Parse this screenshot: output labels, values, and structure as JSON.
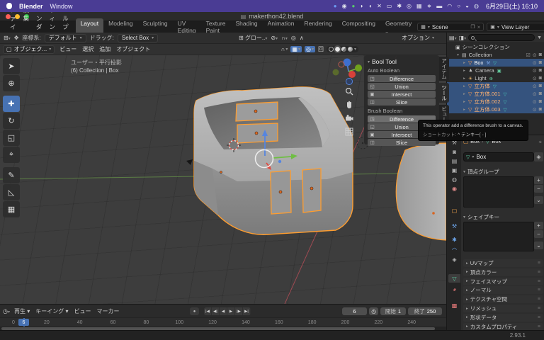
{
  "colors": {
    "accent_blue": "#4772b3",
    "selection_orange": "#ff9d2e",
    "menubar_purple": "#4a3c94",
    "axis_green": "#5c7e45",
    "axis_red": "#9e4a52"
  },
  "menubar": {
    "app_name": "Blender",
    "menus": [
      "Window"
    ],
    "clock": "6月29日(土) 16:10",
    "status_icons": [
      {
        "name": "app-icon-blue",
        "glyph": "●",
        "color": "#6b9bf2"
      },
      {
        "name": "app-icon-camera",
        "glyph": "◉",
        "color": "#dfe3ec"
      },
      {
        "name": "app-icon-green",
        "glyph": "●",
        "color": "#57c76d"
      },
      {
        "name": "speech-icon",
        "glyph": "◗",
        "color": "#e8e8f2"
      },
      {
        "name": "volume-icon",
        "glyph": "◖",
        "color": "#e8e8f2"
      },
      {
        "name": "cut-icon",
        "glyph": "✕",
        "color": "#e8e8f2"
      },
      {
        "name": "display-icon",
        "glyph": "▭",
        "color": "#e8e8f2"
      },
      {
        "name": "settings-icon",
        "glyph": "✱",
        "color": "#e8e8f2"
      },
      {
        "name": "disc-icon",
        "glyph": "◎",
        "color": "#e8e8f2"
      },
      {
        "name": "keyboard-icon",
        "glyph": "▦",
        "color": "#e8e8f2"
      },
      {
        "name": "bluetooth-icon",
        "glyph": "∗",
        "color": "#e8e8f2"
      },
      {
        "name": "battery-icon",
        "glyph": "▬",
        "color": "#e8e8f2"
      },
      {
        "name": "wifi-icon",
        "glyph": "◠",
        "color": "#e8e8f2"
      },
      {
        "name": "search-icon",
        "glyph": "○",
        "color": "#e8e8f2"
      },
      {
        "name": "control-center-icon",
        "glyph": "◒",
        "color": "#e8e8f2"
      },
      {
        "name": "user-icon",
        "glyph": "◍",
        "color": "#cdd4e8"
      }
    ]
  },
  "titlebar": {
    "title": "makerthon42.blend"
  },
  "topbar": {
    "menus": [
      "ファイル",
      "編集",
      "レンダー",
      "ウィンドウ",
      "ヘルプ"
    ],
    "workspaces": [
      {
        "label": "Layout",
        "active": true
      },
      {
        "label": "Modeling"
      },
      {
        "label": "Sculpting"
      },
      {
        "label": "UV Editing"
      },
      {
        "label": "Texture Paint"
      },
      {
        "label": "Shading"
      },
      {
        "label": "Animation"
      },
      {
        "label": "Rendering"
      },
      {
        "label": "Compositing"
      },
      {
        "label": "Geometry .."
      }
    ],
    "scene": {
      "value": "Scene"
    },
    "view_layer": {
      "value": "View Layer"
    }
  },
  "tool_settings": {
    "orientation_label": "座標系:",
    "orientation_value": "デフォルト",
    "drag_label": "ドラッグ:",
    "drag_value": "Select Box",
    "transform_orientation": "グロー..",
    "options_label": "オプション"
  },
  "viewport_header": {
    "mode": "オブジェク...",
    "menus": [
      "ビュー",
      "選択",
      "追加",
      "オブジェクト"
    ]
  },
  "viewport": {
    "overlay_line1": "ユーザー・平行投影",
    "overlay_line2": "(6) Collection | Box"
  },
  "toolbar_tools": [
    {
      "name": "select-box",
      "glyph": "➤"
    },
    {
      "name": "cursor",
      "glyph": "⊕"
    },
    {
      "name": "move",
      "glyph": "✚",
      "active": true
    },
    {
      "name": "rotate",
      "glyph": "↻"
    },
    {
      "name": "scale",
      "glyph": "◱"
    },
    {
      "name": "transform",
      "glyph": "⌖"
    },
    {
      "name": "annotate",
      "glyph": "✎"
    },
    {
      "name": "measure",
      "glyph": "◺"
    },
    {
      "name": "add-cube",
      "glyph": "▦"
    }
  ],
  "bool_tool": {
    "title": "Bool Tool",
    "button_icons": [
      "◳",
      "◱",
      "▣",
      "◫"
    ],
    "sections": [
      {
        "label": "Auto Boolean",
        "buttons": [
          "Difference",
          "Union",
          "Intersect",
          "Slice"
        ]
      },
      {
        "label": "Brush Boolean",
        "buttons": [
          "Difference",
          "Union",
          "Intersect",
          "Slice"
        ],
        "hovered": "Difference"
      }
    ],
    "tabs": [
      {
        "label": "アイテム"
      },
      {
        "label": "ツール",
        "active": true
      },
      {
        "label": "ビュー"
      }
    ]
  },
  "tooltip": {
    "line1": "This operator add a difference brush to a canvas.",
    "line2_label": "ショートカット:",
    "line2_value": "^ テンキー[ - ]"
  },
  "outliner": {
    "rows": [
      {
        "name": "scene-collection",
        "label": "シーンコレクション",
        "expander": "",
        "icon": {
          "name": "scene-collection-icon",
          "glyph": "▣",
          "color": "#c8c8c8"
        },
        "label_color": "#c8c8c8",
        "selected": false,
        "indent": 0,
        "extras": [],
        "toggles": []
      },
      {
        "name": "collection",
        "label": "Collection",
        "expander": "▾",
        "icon": {
          "name": "collection-icon",
          "glyph": "▤",
          "color": "#c8c8c8"
        },
        "label_color": "#c8c8c8",
        "selected": false,
        "indent": 1,
        "extras": [],
        "toggles": [
          {
            "name": "exclude-checkbox",
            "glyph": "☑"
          },
          {
            "name": "hide-eye-icon",
            "glyph": "⊙"
          },
          {
            "name": "disable-render-icon",
            "glyph": "◙"
          }
        ]
      },
      {
        "name": "object-box",
        "label": "Box",
        "expander": "▸",
        "icon": {
          "name": "mesh-object-icon",
          "glyph": "▽",
          "color": "#ff9e52"
        },
        "label_color": "#ffffff",
        "selected": true,
        "indent": 2,
        "extras": [
          {
            "name": "modifier-wrench-icon",
            "glyph": "⚒",
            "color": "#7aa7e8"
          },
          {
            "name": "mesh-data-icon",
            "glyph": "▽",
            "color": "#49c8b8"
          }
        ],
        "toggles": [
          {
            "name": "hide-eye-icon",
            "glyph": "⊙"
          },
          {
            "name": "disable-render-icon",
            "glyph": "◙"
          }
        ]
      },
      {
        "name": "object-camera",
        "label": "Camera",
        "expander": "▸",
        "icon": {
          "name": "camera-object-icon",
          "glyph": "▲",
          "color": "#c8c8c8"
        },
        "label_color": "#c6c6c6",
        "selected": false,
        "indent": 2,
        "extras": [
          {
            "name": "camera-data-icon",
            "glyph": "▣",
            "color": "#63c79a"
          }
        ],
        "toggles": [
          {
            "name": "hide-eye-icon",
            "glyph": "⊙"
          },
          {
            "name": "disable-render-icon",
            "glyph": "◙"
          }
        ]
      },
      {
        "name": "object-light",
        "label": "Light",
        "expander": "▸",
        "icon": {
          "name": "light-object-icon",
          "glyph": "☀",
          "color": "#e8b36a"
        },
        "label_color": "#c6c6c6",
        "selected": false,
        "indent": 2,
        "extras": [
          {
            "name": "light-data-icon",
            "glyph": "⊕",
            "color": "#63c79a"
          }
        ],
        "toggles": [
          {
            "name": "hide-eye-icon",
            "glyph": "⊙"
          },
          {
            "name": "disable-render-icon",
            "glyph": "◙"
          }
        ]
      },
      {
        "name": "object-cube",
        "label": "立方体",
        "expander": "▸",
        "icon": {
          "name": "mesh-object-icon",
          "glyph": "▽",
          "color": "#ff9e52"
        },
        "label_color": "#ffb272",
        "selected": true,
        "indent": 2,
        "extras": [
          {
            "name": "mesh-data-icon",
            "glyph": "▽",
            "color": "#49c8b8"
          }
        ],
        "toggles": [
          {
            "name": "hide-eye-icon",
            "glyph": "⊙"
          },
          {
            "name": "disable-render-icon",
            "glyph": "◙"
          }
        ]
      },
      {
        "name": "object-cube-001",
        "label": "立方体.001",
        "expander": "▸",
        "icon": {
          "name": "mesh-object-icon",
          "glyph": "▽",
          "color": "#ff9e52"
        },
        "label_color": "#ffb272",
        "selected": true,
        "indent": 2,
        "extras": [
          {
            "name": "mesh-data-icon",
            "glyph": "▽",
            "color": "#49c8b8"
          }
        ],
        "toggles": [
          {
            "name": "hide-eye-icon",
            "glyph": "⊙"
          },
          {
            "name": "disable-render-icon",
            "glyph": "◙"
          }
        ]
      },
      {
        "name": "object-cube-002",
        "label": "立方体.002",
        "expander": "▸",
        "icon": {
          "name": "mesh-object-icon",
          "glyph": "▽",
          "color": "#ff9e52"
        },
        "label_color": "#ffb272",
        "selected": true,
        "indent": 2,
        "extras": [
          {
            "name": "mesh-data-icon",
            "glyph": "▽",
            "color": "#49c8b8"
          }
        ],
        "toggles": [
          {
            "name": "hide-eye-icon",
            "glyph": "⊙"
          },
          {
            "name": "disable-render-icon",
            "glyph": "◙"
          }
        ]
      },
      {
        "name": "object-cube-003",
        "label": "立方体.003",
        "expander": "▸",
        "icon": {
          "name": "mesh-object-icon",
          "glyph": "▽",
          "color": "#ff9e52"
        },
        "label_color": "#ffb272",
        "selected": true,
        "indent": 2,
        "extras": [
          {
            "name": "mesh-data-icon",
            "glyph": "▽",
            "color": "#49c8b8"
          }
        ],
        "toggles": [
          {
            "name": "hide-eye-icon",
            "glyph": "⊙"
          },
          {
            "name": "disable-render-icon",
            "glyph": "◙"
          }
        ]
      }
    ]
  },
  "properties": {
    "tabs": [
      {
        "name": "tool",
        "glyph": "⚒",
        "color": "#b4b4b4"
      },
      {
        "name": "render",
        "glyph": "◙",
        "color": "#b4b4b4"
      },
      {
        "name": "output",
        "glyph": "▤",
        "color": "#b4b4b4"
      },
      {
        "name": "view-layer",
        "glyph": "▣",
        "color": "#b4b4b4"
      },
      {
        "name": "scene",
        "glyph": "◍",
        "color": "#b4b4b4"
      },
      {
        "name": "world",
        "glyph": "◉",
        "color": "#e08a8a"
      },
      {
        "name": "object",
        "glyph": "▢",
        "color": "#f0a24a"
      },
      {
        "name": "modifiers",
        "glyph": "⚒",
        "color": "#6aa3e8"
      },
      {
        "name": "particles",
        "glyph": "✱",
        "color": "#6aa3e8"
      },
      {
        "name": "physics",
        "glyph": "◠",
        "color": "#6aa3e8"
      },
      {
        "name": "constraints",
        "glyph": "◈",
        "color": "#b4b4b4"
      },
      {
        "name": "object-data",
        "glyph": "▽",
        "color": "#5fd0a5",
        "active": true
      },
      {
        "name": "material",
        "glyph": "◕",
        "color": "#e87a7a"
      },
      {
        "name": "texture",
        "glyph": "▩",
        "color": "#e87a7a"
      }
    ],
    "breadcrumb": {
      "object_label": "Box",
      "data_label": "Box"
    },
    "name_field": {
      "value": "Box"
    },
    "vertex_groups": {
      "label": "頂点グループ"
    },
    "shape_keys": {
      "label": "シェイプキー"
    },
    "list_buttons": [
      "+",
      "−",
      "⌄"
    ],
    "collapsed_sections": [
      "UVマップ",
      "頂点カラー",
      "フェイスマップ",
      "ノーマル",
      "テクスチャ空間",
      "リメッシュ",
      "形状データ",
      "カスタムプロパティ"
    ]
  },
  "timeline": {
    "menus": [
      {
        "label": "再生",
        "dropdown": true
      },
      {
        "label": "キーイング",
        "dropdown": true
      },
      {
        "label": "ビュー",
        "dropdown": false
      },
      {
        "label": "マーカー",
        "dropdown": false
      }
    ],
    "record_icon": "●",
    "transport": [
      {
        "name": "jump-to-start",
        "glyph": "|◀"
      },
      {
        "name": "prev-keyframe",
        "glyph": "◀|"
      },
      {
        "name": "play-reverse",
        "glyph": "◀"
      },
      {
        "name": "play",
        "glyph": "▶"
      },
      {
        "name": "next-keyframe",
        "glyph": "|▶"
      },
      {
        "name": "jump-to-end",
        "glyph": "▶|"
      }
    ],
    "current_frame": "6",
    "start_label": "開始",
    "start_value": "1",
    "end_label": "終了",
    "end_value": "250",
    "playhead_label": "6",
    "ticks": [
      "0",
      "20",
      "40",
      "60",
      "80",
      "100",
      "120",
      "140",
      "160",
      "180",
      "200",
      "220",
      "240"
    ]
  },
  "statusbar": {
    "version": "2.93.1"
  }
}
